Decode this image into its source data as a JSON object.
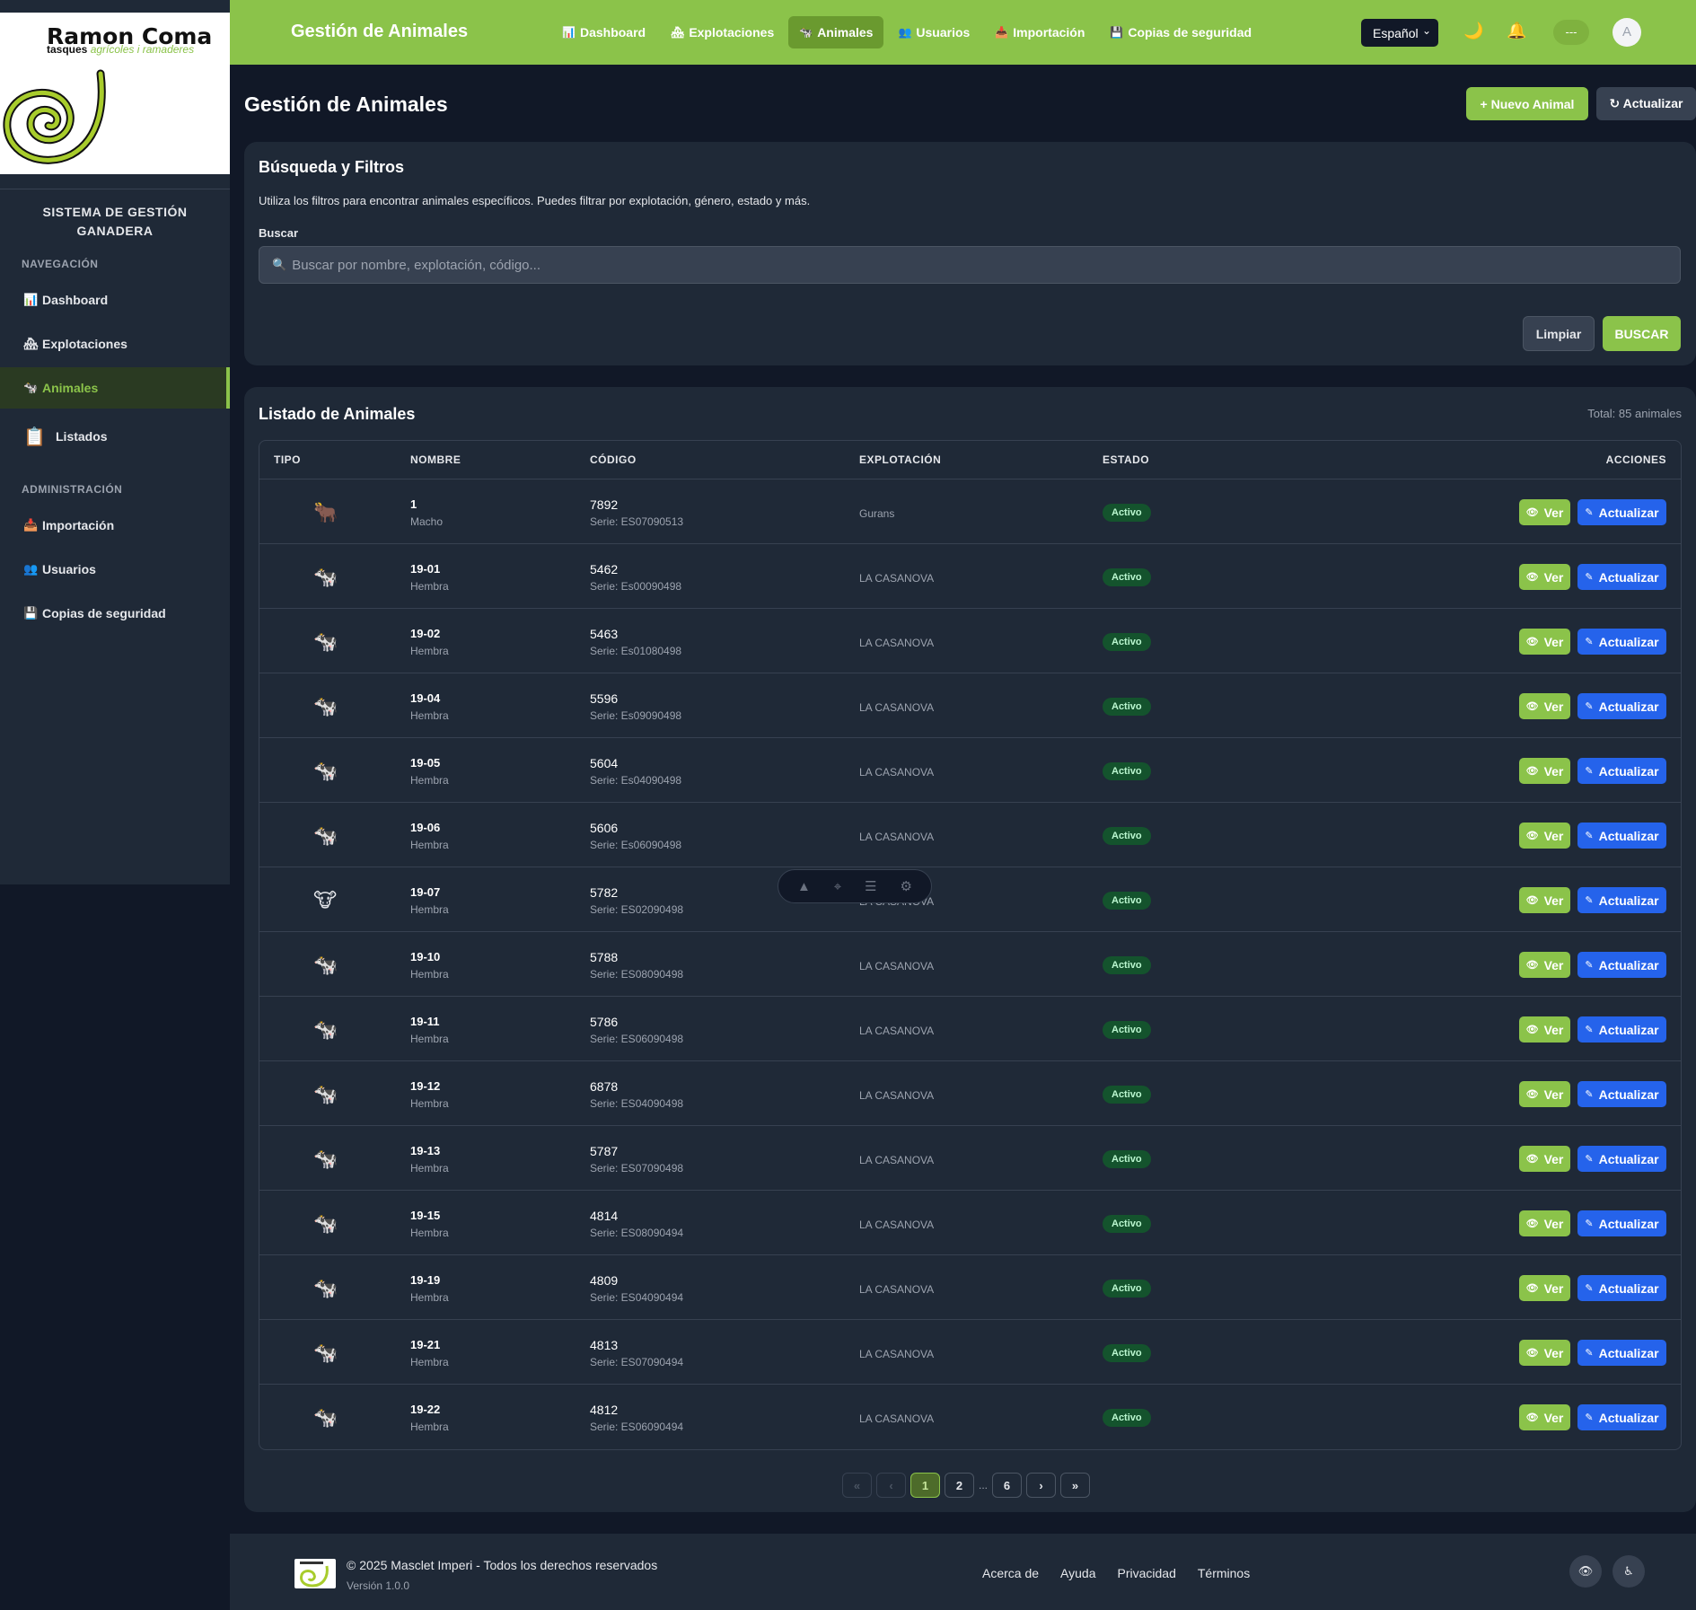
{
  "logo": {
    "title": "Ramon Coma",
    "sub_a": "tasques",
    "sub_b": "agrícoles i ramaderes"
  },
  "sidebar": {
    "system_title_1": "SISTEMA DE GESTIÓN",
    "system_title_2": "GANADERA",
    "nav_section": "NAVEGACIÓN",
    "admin_section": "ADMINISTRACIÓN",
    "nav_items": [
      {
        "label": "Dashboard",
        "icon": "📊"
      },
      {
        "label": "Explotaciones",
        "icon": "🏘"
      },
      {
        "label": "Animales",
        "icon": "🐄"
      },
      {
        "label": "Listados",
        "icon": "📋"
      }
    ],
    "admin_items": [
      {
        "label": "Importación",
        "icon": "📥"
      },
      {
        "label": "Usuarios",
        "icon": "👥"
      },
      {
        "label": "Copias de seguridad",
        "icon": "💾"
      }
    ]
  },
  "topbar": {
    "title": "Gestión de Animales",
    "nav": [
      {
        "label": "Dashboard",
        "icon": "📊"
      },
      {
        "label": "Explotaciones",
        "icon": "🏘"
      },
      {
        "label": "Animales",
        "icon": "🐄"
      },
      {
        "label": "Usuarios",
        "icon": "👥"
      },
      {
        "label": "Importación",
        "icon": "📥"
      },
      {
        "label": "Copias de seguridad",
        "icon": "💾"
      }
    ],
    "language": "Español",
    "dash_pill": "---",
    "avatar": "A"
  },
  "page": {
    "title": "Gestión de Animales",
    "new_button": "+ Nuevo Animal",
    "refresh_button": "↻ Actualizar"
  },
  "filters": {
    "title": "Búsqueda y Filtros",
    "description": "Utiliza los filtros para encontrar animales específicos. Puedes filtrar por explotación, género, estado y más.",
    "search_label": "Buscar",
    "search_placeholder": "Buscar por nombre, explotación, código...",
    "clear_button": "Limpiar",
    "search_button": "BUSCAR"
  },
  "list": {
    "title": "Listado de Animales",
    "total": "Total: 85 animales",
    "headers": {
      "type": "TIPO",
      "name": "NOMBRE",
      "code": "CÓDIGO",
      "farm": "EXPLOTACIÓN",
      "status": "ESTADO",
      "actions": "ACCIONES"
    },
    "view_label": "Ver",
    "update_label": "Actualizar",
    "rows": [
      {
        "icon": "🐂",
        "name": "1",
        "gender": "Macho",
        "code": "7892",
        "serie": "Serie: ES07090513",
        "farm": "Gurans",
        "status": "Activo"
      },
      {
        "icon": "🐄",
        "name": "19-01",
        "gender": "Hembra",
        "code": "5462",
        "serie": "Serie: Es00090498",
        "farm": "LA CASANOVA",
        "status": "Activo"
      },
      {
        "icon": "🐄",
        "name": "19-02",
        "gender": "Hembra",
        "code": "5463",
        "serie": "Serie: Es01080498",
        "farm": "LA CASANOVA",
        "status": "Activo"
      },
      {
        "icon": "🐄",
        "name": "19-04",
        "gender": "Hembra",
        "code": "5596",
        "serie": "Serie: Es09090498",
        "farm": "LA CASANOVA",
        "status": "Activo"
      },
      {
        "icon": "🐄",
        "name": "19-05",
        "gender": "Hembra",
        "code": "5604",
        "serie": "Serie: Es04090498",
        "farm": "LA CASANOVA",
        "status": "Activo"
      },
      {
        "icon": "🐄",
        "name": "19-06",
        "gender": "Hembra",
        "code": "5606",
        "serie": "Serie: Es06090498",
        "farm": "LA CASANOVA",
        "status": "Activo"
      },
      {
        "icon": "🐮",
        "name": "19-07",
        "gender": "Hembra",
        "code": "5782",
        "serie": "Serie: ES02090498",
        "farm": "LA CASANOVA",
        "status": "Activo"
      },
      {
        "icon": "🐄",
        "name": "19-10",
        "gender": "Hembra",
        "code": "5788",
        "serie": "Serie: ES08090498",
        "farm": "LA CASANOVA",
        "status": "Activo"
      },
      {
        "icon": "🐄",
        "name": "19-11",
        "gender": "Hembra",
        "code": "5786",
        "serie": "Serie: ES06090498",
        "farm": "LA CASANOVA",
        "status": "Activo"
      },
      {
        "icon": "🐄",
        "name": "19-12",
        "gender": "Hembra",
        "code": "6878",
        "serie": "Serie: ES04090498",
        "farm": "LA CASANOVA",
        "status": "Activo"
      },
      {
        "icon": "🐄",
        "name": "19-13",
        "gender": "Hembra",
        "code": "5787",
        "serie": "Serie: ES07090498",
        "farm": "LA CASANOVA",
        "status": "Activo"
      },
      {
        "icon": "🐄",
        "name": "19-15",
        "gender": "Hembra",
        "code": "4814",
        "serie": "Serie: ES08090494",
        "farm": "LA CASANOVA",
        "status": "Activo"
      },
      {
        "icon": "🐄",
        "name": "19-19",
        "gender": "Hembra",
        "code": "4809",
        "serie": "Serie: ES04090494",
        "farm": "LA CASANOVA",
        "status": "Activo"
      },
      {
        "icon": "🐄",
        "name": "19-21",
        "gender": "Hembra",
        "code": "4813",
        "serie": "Serie: ES07090494",
        "farm": "LA CASANOVA",
        "status": "Activo"
      },
      {
        "icon": "🐄",
        "name": "19-22",
        "gender": "Hembra",
        "code": "4812",
        "serie": "Serie: ES06090494",
        "farm": "LA CASANOVA",
        "status": "Activo"
      }
    ]
  },
  "pagination": {
    "first": "«",
    "prev": "‹",
    "pages": [
      "1",
      "2"
    ],
    "ellipsis": "...",
    "last_page": "6",
    "next": "›",
    "last": "»",
    "current": "1"
  },
  "footer": {
    "copyright": "© 2025 Masclet Imperi - Todos los derechos reservados",
    "version": "Versión 1.0.0",
    "links": [
      "Acerca de",
      "Ayuda",
      "Privacidad",
      "Términos"
    ]
  },
  "colors": {
    "accent": "#8bc34a",
    "update_blue": "#2563eb",
    "background": "#111827",
    "card": "#1f2937",
    "status_green": "#14532d"
  }
}
